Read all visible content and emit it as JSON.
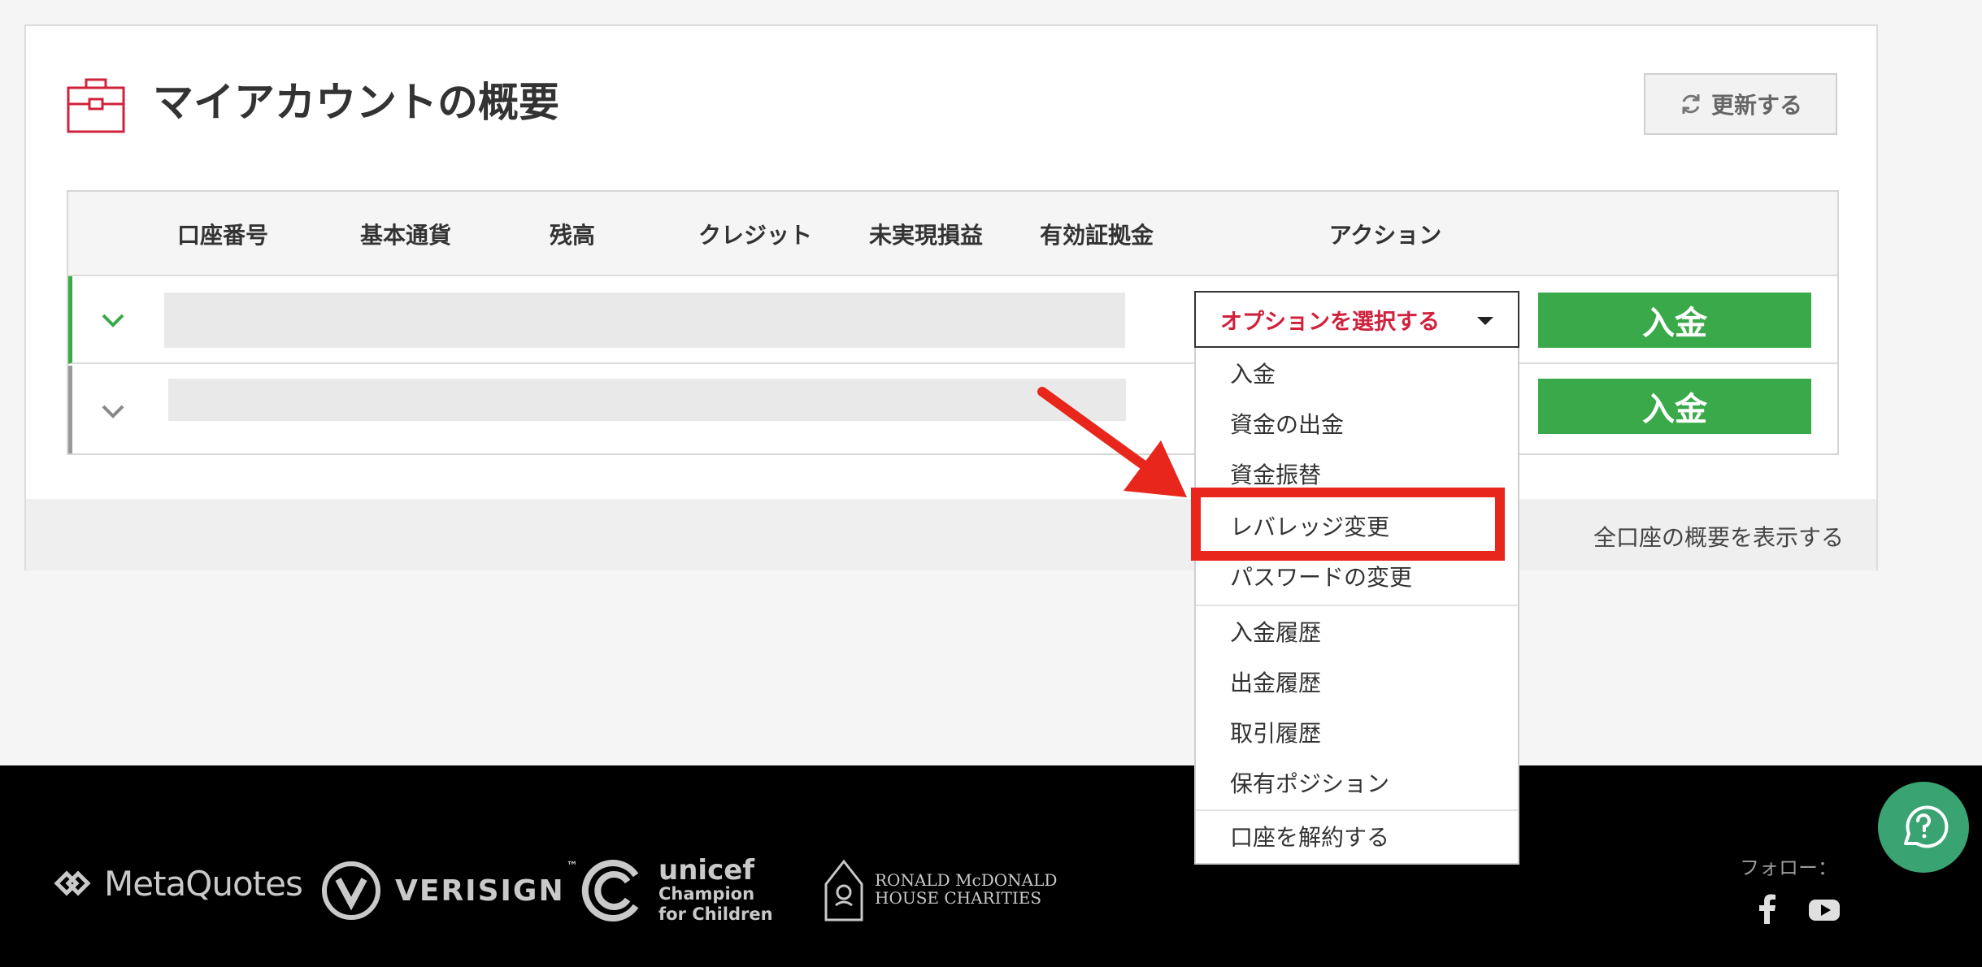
{
  "header": {
    "title": "マイアカウントの概要",
    "refresh_label": "更新する"
  },
  "table": {
    "columns": [
      "口座番号",
      "基本通貨",
      "残高",
      "クレジット",
      "未実現損益",
      "有効証拠金",
      "アクション"
    ],
    "rows": [
      {
        "select_label": "オプションを選択する",
        "deposit_label": "入金",
        "expanded": true
      },
      {
        "deposit_label": "入金",
        "expanded": false
      }
    ]
  },
  "dropdown": {
    "items": [
      "入金",
      "資金の出金",
      "資金振替",
      "レバレッジ変更",
      "パスワードの変更",
      "入金履歴",
      "出金履歴",
      "取引履歴",
      "保有ポジション",
      "口座を解約する"
    ],
    "highlighted": "レバレッジ変更"
  },
  "view_all_label": "全口座の概要を表示する",
  "footer": {
    "logos": {
      "metaquotes": "MetaQuotes",
      "verisign": "VERISIGN",
      "verisign_tm": "™",
      "unicef": "unicef",
      "unicef_line1": "Champion",
      "unicef_line2": "for Children",
      "rmhc_line1": "RONALD McDONALD",
      "rmhc_line2": "HOUSE CHARITIES"
    },
    "follow_label": "フォロー：",
    "social": [
      "facebook-icon",
      "youtube-icon"
    ]
  },
  "colors": {
    "accent_green": "#3aa94a",
    "accent_red": "#d0213d",
    "highlight_red": "#e8261c",
    "help_green": "#3aa372"
  }
}
